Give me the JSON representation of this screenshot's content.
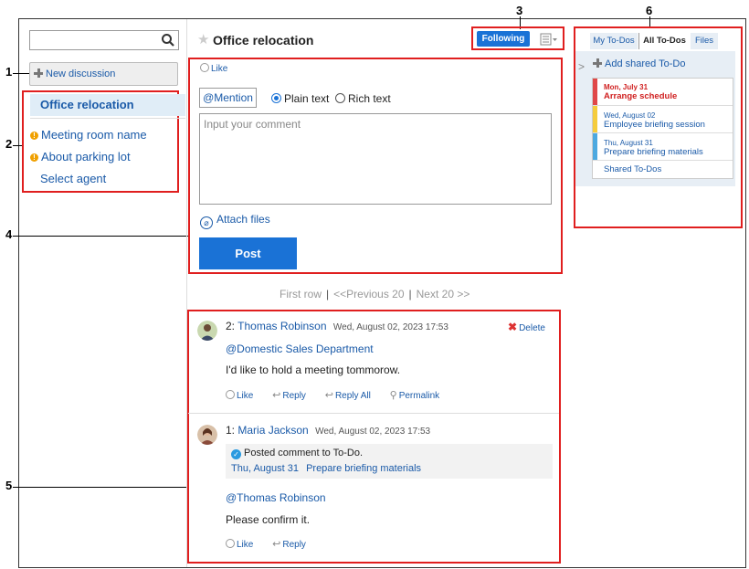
{
  "callouts": [
    "1",
    "2",
    "3",
    "4",
    "5",
    "6"
  ],
  "search": {
    "placeholder": ""
  },
  "left": {
    "new_discussion": "New discussion",
    "active_topic": "Office relocation",
    "topics": [
      {
        "label": "Meeting room name",
        "warning": true
      },
      {
        "label": "About parking lot",
        "warning": true
      },
      {
        "label": "Select agent",
        "warning": false
      }
    ]
  },
  "header": {
    "title": "Office relocation",
    "following": "Following"
  },
  "composer": {
    "like": "Like",
    "mention": "@Mention",
    "plain_text": "Plain text",
    "rich_text": "Rich text",
    "placeholder": "Input your comment",
    "attach": "Attach files",
    "post": "Post"
  },
  "pager": {
    "first": "First row",
    "prev": "<<Previous 20",
    "next": "Next 20 >>"
  },
  "comments": [
    {
      "num": "2:",
      "author": "Thomas Robinson",
      "date": "Wed, August 02, 2023 17:53",
      "delete": "Delete",
      "mention": "@Domestic Sales Department",
      "body": "I'd like to hold a meeting tommorow.",
      "actions": {
        "like": "Like",
        "reply": "Reply",
        "reply_all": "Reply All",
        "permalink": "Permalink"
      }
    },
    {
      "num": "1:",
      "author": "Maria Jackson",
      "date": "Wed, August 02, 2023 17:53",
      "todo_note": "Posted comment to To-Do.",
      "todo_date": "Thu, August 31",
      "todo_name": "Prepare briefing materials",
      "mention": "@Thomas Robinson",
      "body": "Please confirm it.",
      "actions": {
        "like": "Like",
        "reply": "Reply"
      }
    }
  ],
  "todos": {
    "tabs": [
      "My To-Dos",
      "All To-Dos",
      "Files"
    ],
    "add": "Add shared To-Do",
    "items": [
      {
        "date": "Mon, July 31",
        "name": "Arrange schedule",
        "color": "#e04848",
        "overdue": true
      },
      {
        "date": "Wed, August 02",
        "name": "Employee briefing session",
        "color": "#f5cc3c",
        "overdue": false
      },
      {
        "date": "Thu, August 31",
        "name": "Prepare briefing materials",
        "color": "#4da9e0",
        "overdue": false
      }
    ],
    "shared_link": "Shared To-Dos"
  }
}
